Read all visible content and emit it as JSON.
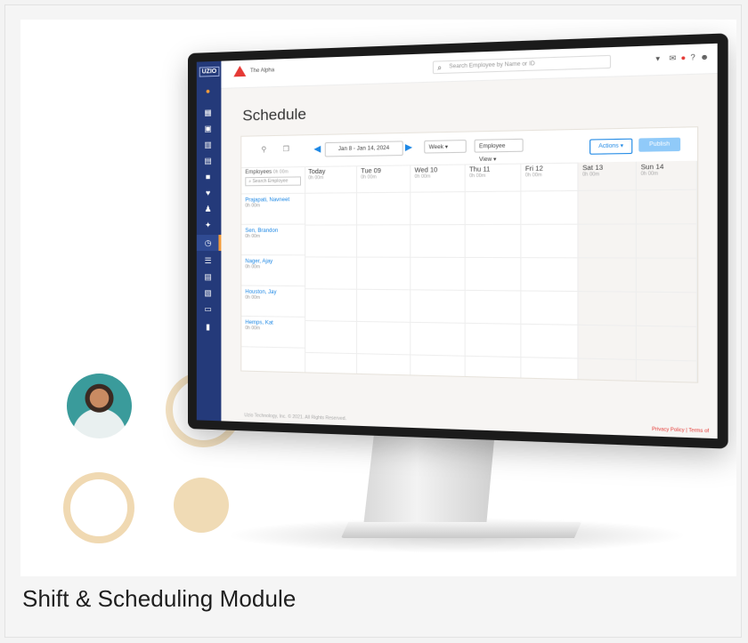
{
  "caption": "Shift & Scheduling Module",
  "app": {
    "logo": "UZIO",
    "brand": "The Alpha",
    "search_placeholder": "Search Employee by Name or ID",
    "page_title": "Schedule",
    "toolbar": {
      "date_range": "Jan 8 - Jan 14, 2024",
      "view": "Week",
      "mode": "Employee View ▾",
      "actions": "Actions ▾",
      "publish": "Publish"
    },
    "employees_header": "Employees",
    "employees_header_hrs": "0h 00m",
    "employee_search": "Search Employee",
    "days": [
      {
        "name": "Today",
        "hrs": "0h 00m"
      },
      {
        "name": "Tue 09",
        "hrs": "0h 00m"
      },
      {
        "name": "Wed 10",
        "hrs": "0h 00m"
      },
      {
        "name": "Thu 11",
        "hrs": "0h 00m"
      },
      {
        "name": "Fri 12",
        "hrs": "0h 00m"
      },
      {
        "name": "Sat 13",
        "hrs": "0h 00m"
      },
      {
        "name": "Sun 14",
        "hrs": "0h 00m"
      }
    ],
    "employees": [
      {
        "name": "Prajapati, Navneet",
        "hrs": "0h 00m"
      },
      {
        "name": "Sen, Brandon",
        "hrs": "0h 00m"
      },
      {
        "name": "Nager, Ajay",
        "hrs": "0h 00m"
      },
      {
        "name": "Houston, Jay",
        "hrs": "0h 00m"
      },
      {
        "name": "Hemps, Kat",
        "hrs": "0h 00m"
      }
    ],
    "footer_left": "Uzio Technology, Inc. © 2021. All Rights Reserved.",
    "footer_right": "Privacy Policy | Terms of"
  },
  "colors": {
    "sidebar": "#243a7a",
    "accent": "#1e88e5",
    "ring": "#f1dfbf"
  }
}
